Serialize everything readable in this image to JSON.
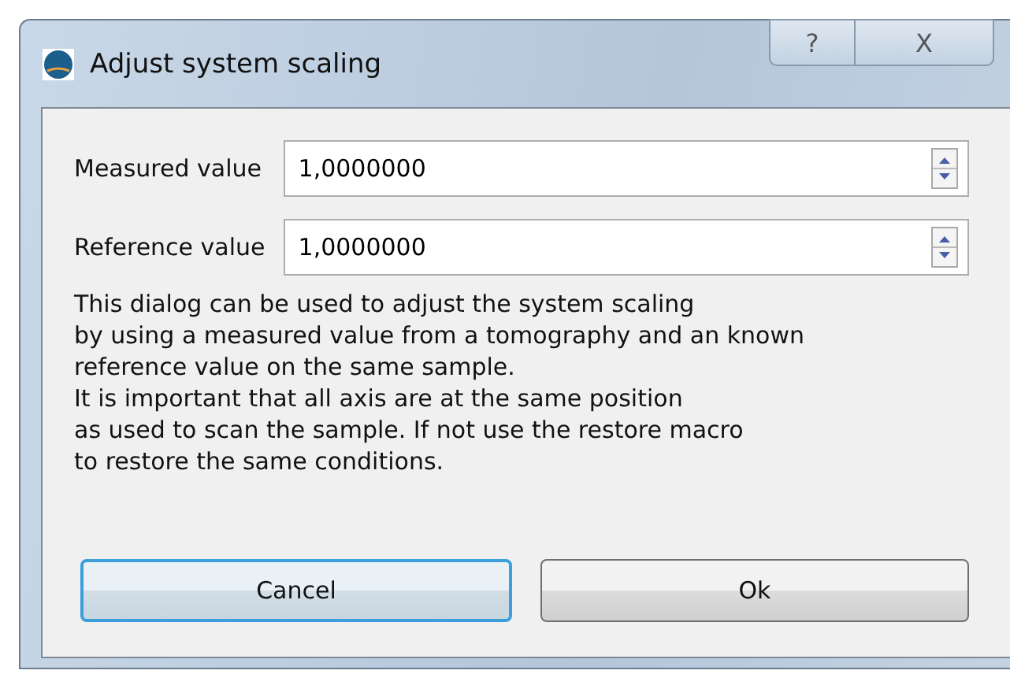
{
  "window": {
    "title": "Adjust system scaling",
    "buttons": [
      "?",
      "X"
    ]
  },
  "fields": [
    {
      "label": "Measured value",
      "value": "1,0000000"
    },
    {
      "label": "Reference value",
      "value": "1,0000000"
    }
  ],
  "description": "This dialog can be used to adjust the system scaling\nby using a measured value from a tomography and an known\nreference value on the same sample.\nIt is important that all axis are at the same position\nas used to scan the sample. If not use the restore macro\nto restore the same conditions.",
  "buttons": [
    {
      "label": "Cancel",
      "focused": true
    },
    {
      "label": "Ok",
      "focused": false
    }
  ]
}
